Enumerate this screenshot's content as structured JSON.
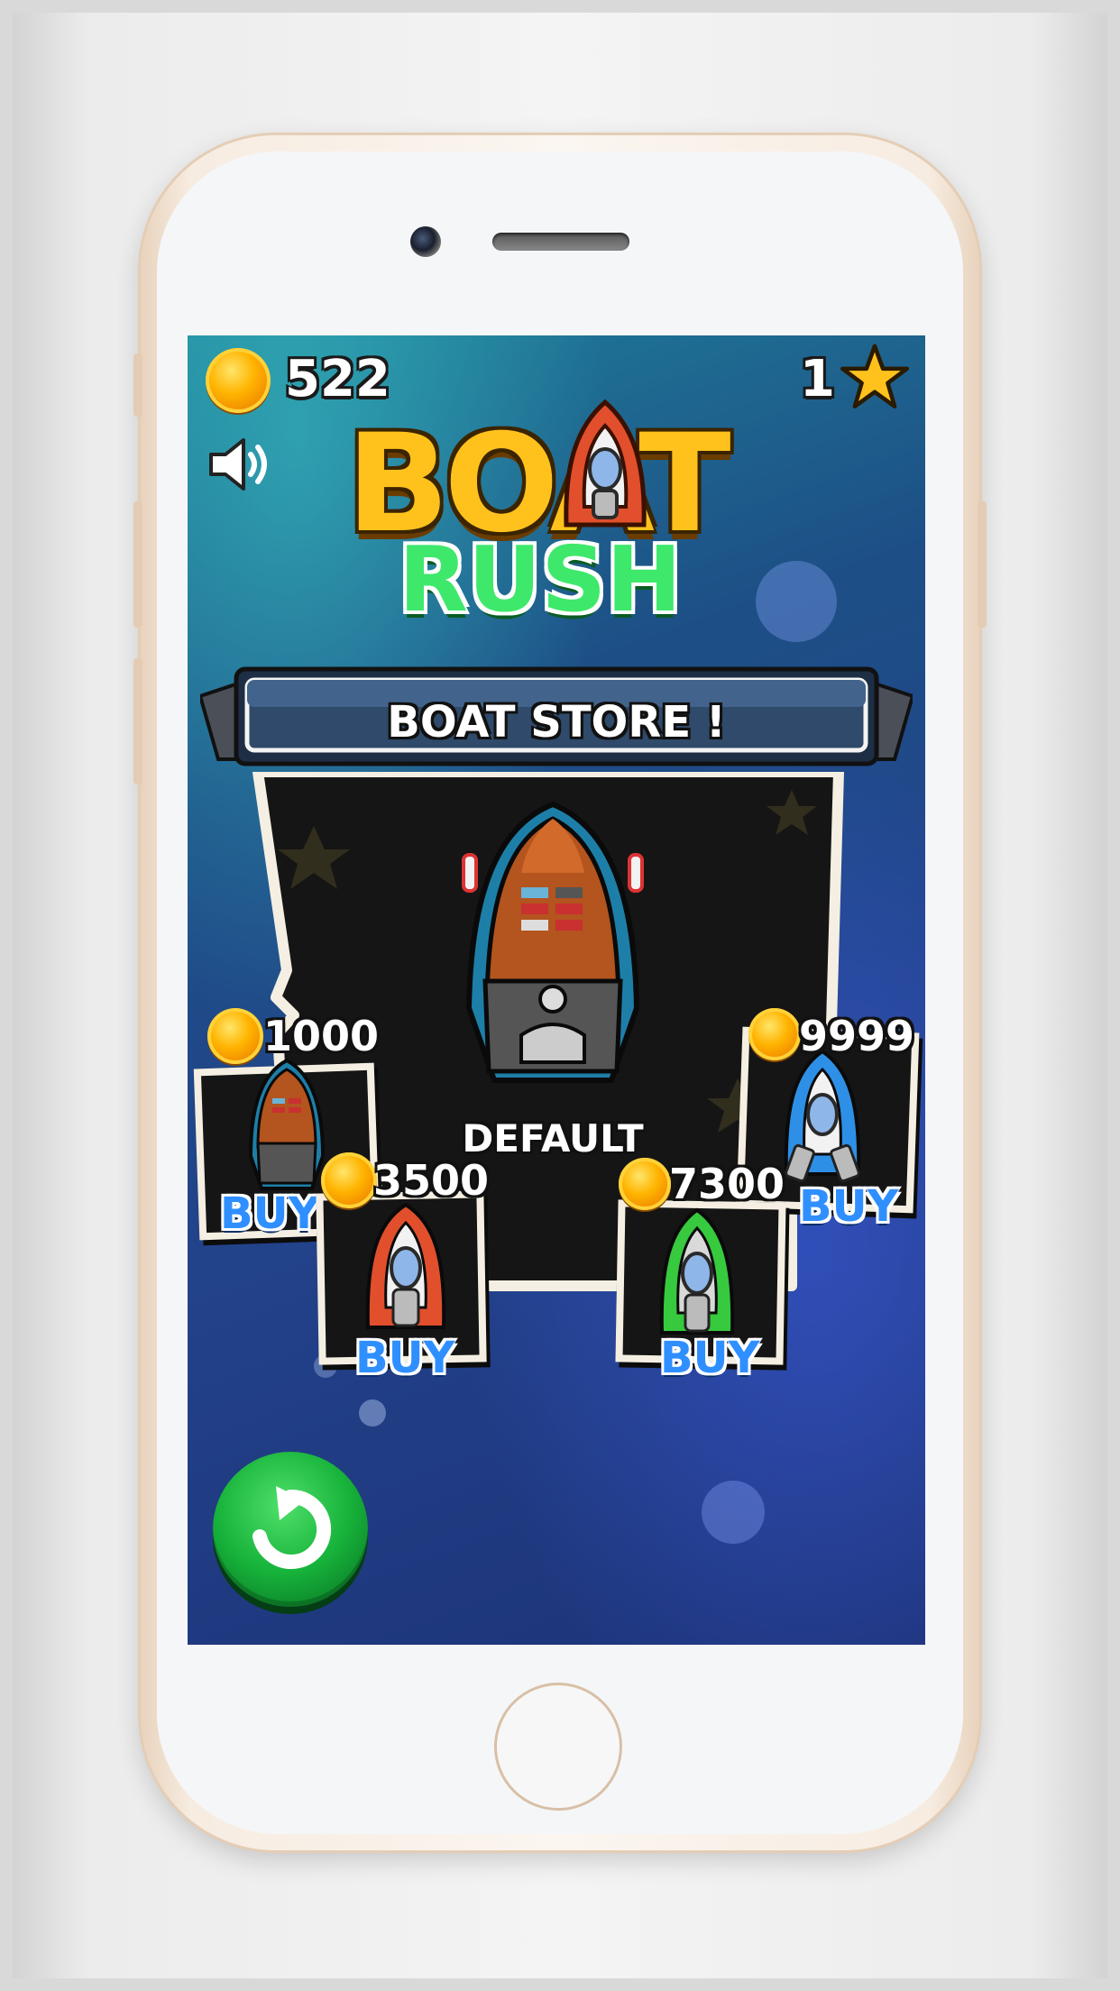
{
  "hud": {
    "coins": "522",
    "stars": "1",
    "coin_icon": "coin-icon",
    "star_icon": "star-icon",
    "sound_icon": "speaker-icon"
  },
  "logo": {
    "line1": "BOAT",
    "line2": "RUSH"
  },
  "store": {
    "title": "BOAT STORE !",
    "selected_label": "DEFAULT",
    "items": [
      {
        "price": "1000",
        "buy_label": "BUY",
        "color": "#b4541e"
      },
      {
        "price": "3500",
        "buy_label": "BUY",
        "color": "#e14f2c"
      },
      {
        "price": "7300",
        "buy_label": "BUY",
        "color": "#37c93e"
      },
      {
        "price": "9999",
        "buy_label": "BUY",
        "color": "#2e8fe6"
      }
    ]
  },
  "controls": {
    "replay_icon": "replay-icon"
  },
  "colors": {
    "accent_yellow": "#ffc21d",
    "accent_green": "#3ee86b",
    "buy_blue": "#2f8fff"
  }
}
